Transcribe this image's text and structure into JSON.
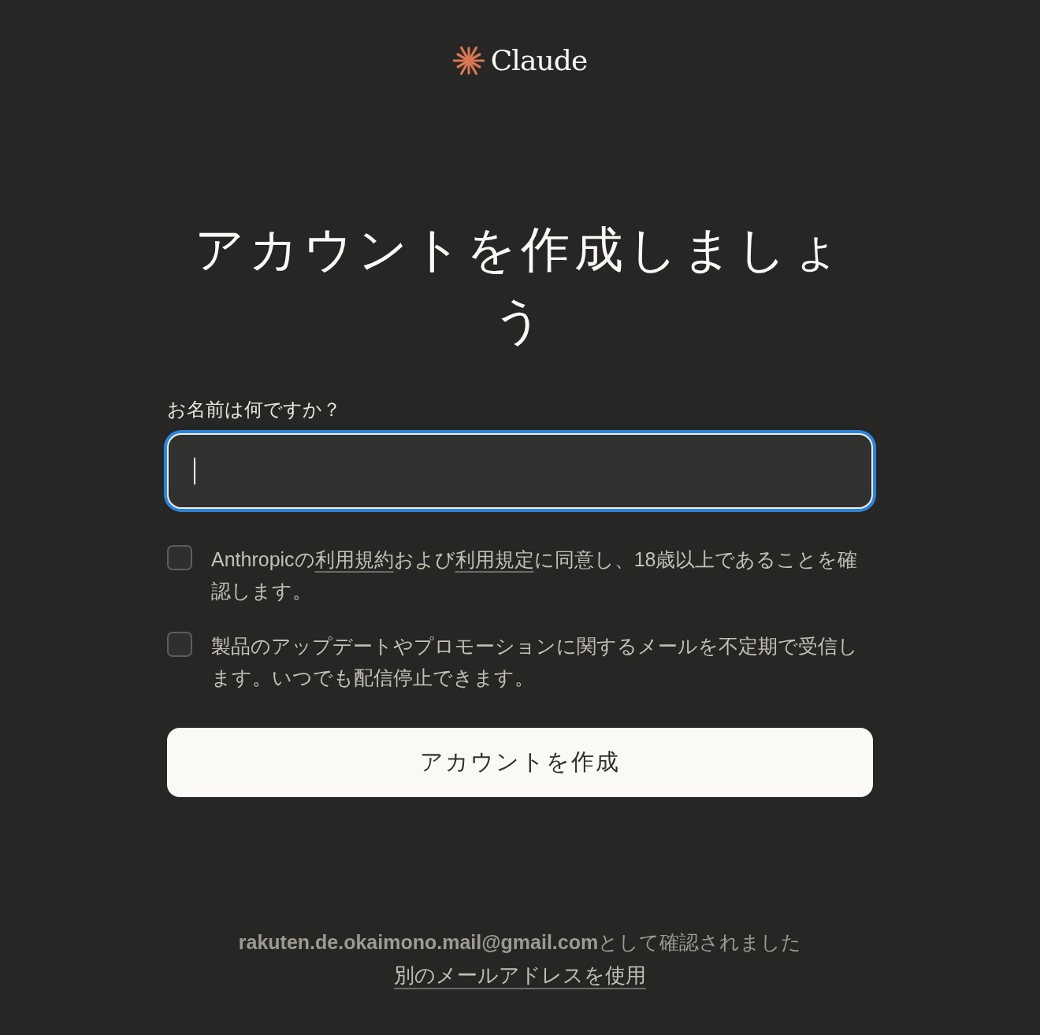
{
  "logo": {
    "text": "Claude"
  },
  "heading": "アカウントを作成しましょう",
  "name_field": {
    "label": "お名前は何ですか？",
    "focused": true
  },
  "checkboxes": [
    {
      "checked": false,
      "parts": [
        {
          "kind": "text",
          "text": "Anthropicの"
        },
        {
          "kind": "link",
          "text": "利用規約"
        },
        {
          "kind": "text",
          "text": "および"
        },
        {
          "kind": "link",
          "text": "利用規定"
        },
        {
          "kind": "text",
          "text": "に同意し、18歳以上であることを確認します。"
        }
      ]
    },
    {
      "checked": false,
      "parts": [
        {
          "kind": "text",
          "text": "製品のアップデートやプロモーションに関するメールを不定期で受信します。いつでも配信停止できます。"
        }
      ]
    }
  ],
  "submit_button": "アカウントを作成",
  "footer": {
    "verified": "**rakuten.de.okaimono.mail@gmail.com**として確認されました",
    "link": "別のメールアドレスを使用"
  }
}
